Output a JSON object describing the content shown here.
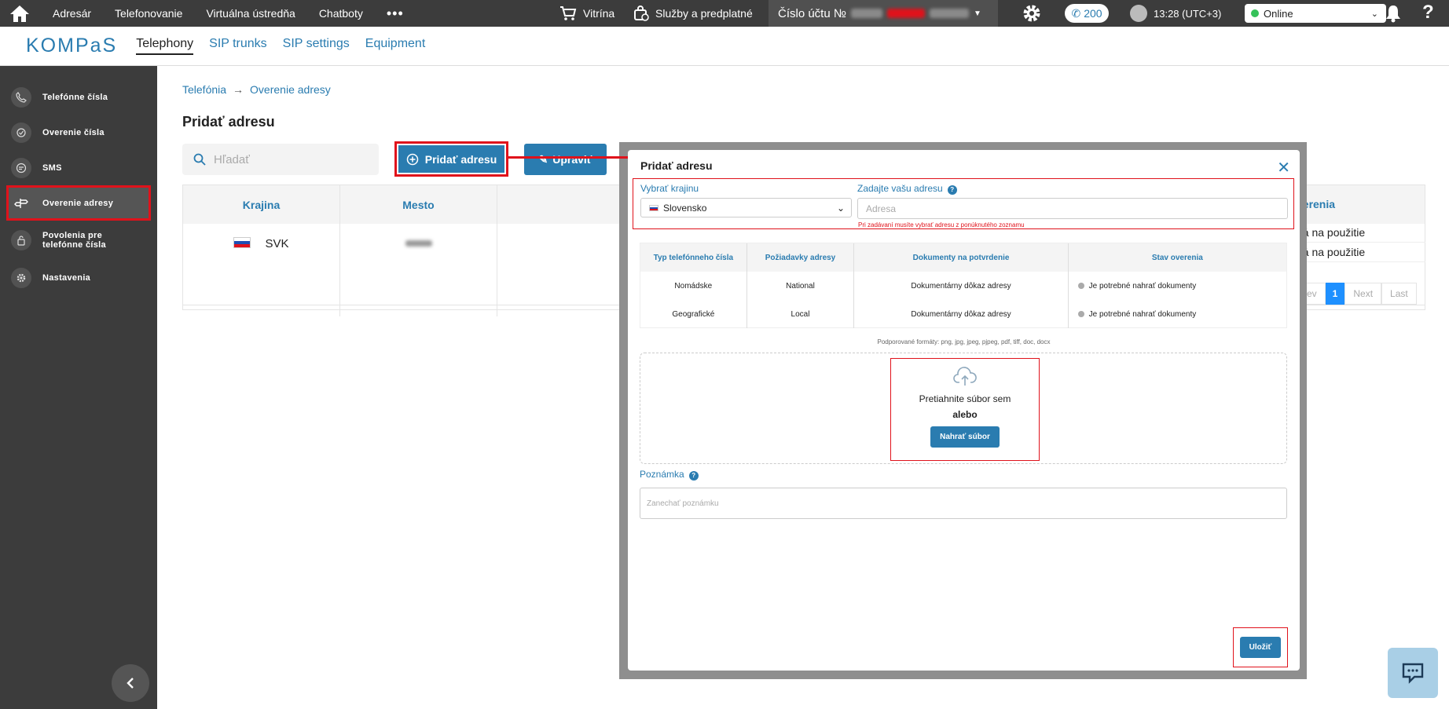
{
  "topbar": {
    "nav": [
      "Adresár",
      "Telefonovanie",
      "Virtuálna ústredňa",
      "Chatboty"
    ],
    "more": "•••",
    "shop": "Vitrína",
    "services": "Služby a predplatné",
    "account_label": "Číslo účtu №",
    "calls": "200",
    "time": "13:28 (UTC+3)",
    "status": "Online"
  },
  "subbar": {
    "logo": "KOMPaS",
    "tabs": [
      "Telephony",
      "SIP trunks",
      "SIP settings",
      "Equipment"
    ]
  },
  "sidebar": {
    "items": [
      {
        "label": "Telefónne čísla"
      },
      {
        "label": "Overenie čísla"
      },
      {
        "label": "SMS"
      },
      {
        "label": "Overenie adresy"
      },
      {
        "label": "Povolenia pre telefónne čísla"
      },
      {
        "label": "Nastavenia"
      }
    ]
  },
  "breadcrumb": {
    "root": "Telefónia",
    "arrow": "→",
    "current": "Overenie adresy"
  },
  "page": {
    "title": "Pridať adresu",
    "search_placeholder": "Hľadať",
    "add_button": "Pridať adresu",
    "edit_button": "Upraviť"
  },
  "table": {
    "headers": [
      "Krajina",
      "Mesto"
    ],
    "right_header": "verenia",
    "row": {
      "country": "SVK"
    },
    "right_values": [
      "ná na použitie",
      "ná na použitie"
    ],
    "pager": [
      "rev",
      "1",
      "Next",
      "Last"
    ]
  },
  "modal": {
    "title": "Pridať adresu",
    "country_label": "Vybrať krajinu",
    "country_value": "Slovensko",
    "address_label": "Zadajte vašu adresu",
    "address_placeholder": "Adresa",
    "address_error": "Pri zadávaní musíte vybrať adresu z ponúknutého zoznamu",
    "req_headers": [
      "Typ telefónneho čísla",
      "Požiadavky adresy",
      "Dokumenty na potvrdenie",
      "Stav overenia"
    ],
    "req_rows": [
      [
        "Nomádske",
        "National",
        "Dokumentárny dôkaz adresy",
        "Je potrebné nahrať dokumenty"
      ],
      [
        "Geografické",
        "Local",
        "Dokumentárny dôkaz adresy",
        "Je potrebné nahrať dokumenty"
      ]
    ],
    "formats": "Podporované formáty: png, jpg, jpeg, pjpeg, pdf, tiff, doc, docx",
    "drop_text": "Pretiahnite súbor sem",
    "or_text": "alebo",
    "upload_button": "Nahrať súbor",
    "note_label": "Poznámka",
    "note_placeholder": "Zanechať poznámku",
    "save_button": "Uložiť"
  }
}
